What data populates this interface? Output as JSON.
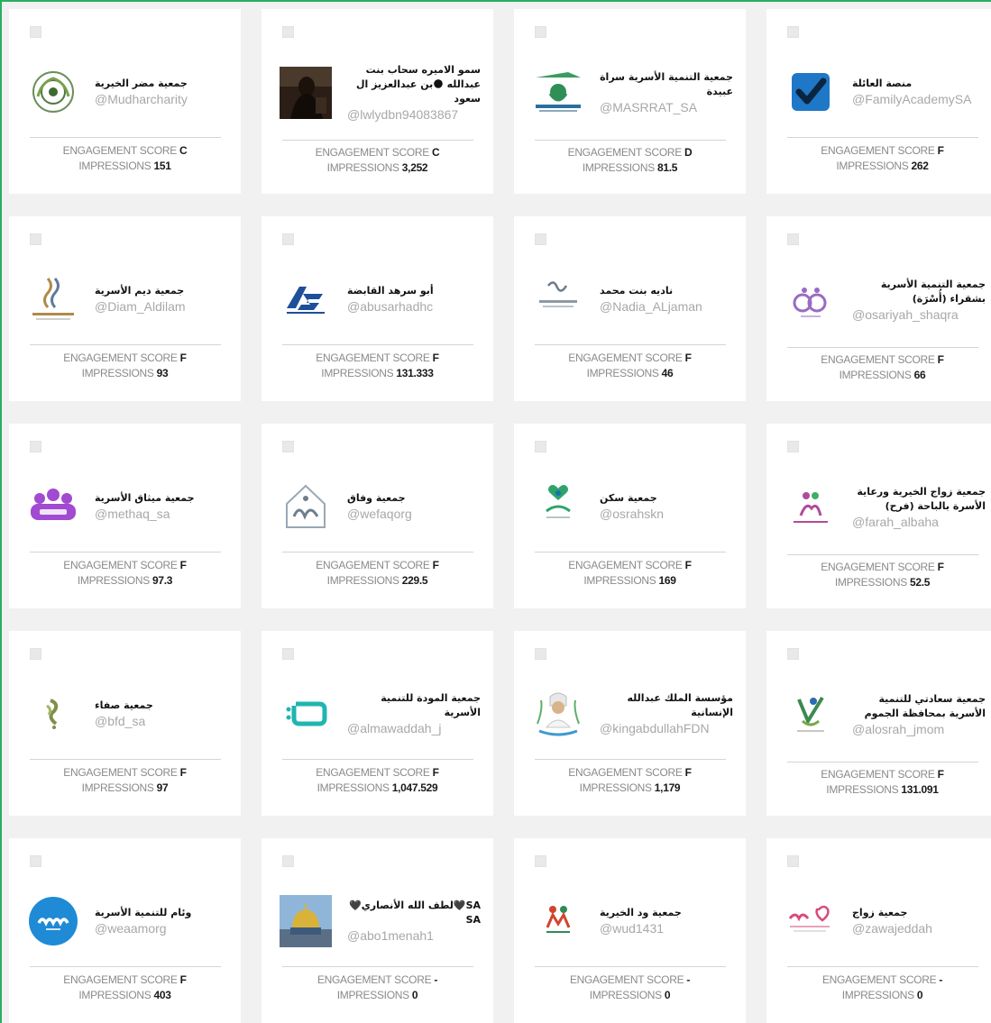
{
  "labels": {
    "engagement": "ENGAGEMENT SCORE",
    "impressions": "IMPRESSIONS"
  },
  "cards": [
    {
      "name": "جمعية مضر الخيرية",
      "handle": "@Mudharcharity",
      "score": "C",
      "impressions": "151",
      "avatar": "mudhar-logo"
    },
    {
      "name": "سمو الاميره سحاب بنت عبدالله 🌑بن عبدالعزيز ال سعود",
      "handle": "@lwlydbn94083867",
      "score": "C",
      "impressions": "3,252",
      "avatar": "profile-photo"
    },
    {
      "name": "جمعية التنمية الأسرية سراة عبيدة",
      "handle": "@MASRRAT_SA",
      "score": "D",
      "impressions": "81.5",
      "avatar": "masrrat-logo"
    },
    {
      "name": "منصة العائلة",
      "handle": "@FamilyAcademySA",
      "score": "F",
      "impressions": "262",
      "avatar": "checkmark-logo"
    },
    {
      "name": "جمعية ديم الأسرية",
      "handle": "@Diam_Aldilam",
      "score": "F",
      "impressions": "93",
      "avatar": "diam-logo"
    },
    {
      "name": "أبو سرهد القابضة",
      "handle": "@abusarhadhc",
      "score": "F",
      "impressions": "131.333",
      "avatar": "abusarhad-logo"
    },
    {
      "name": "ناديه بنت محمد",
      "handle": "@Nadia_ALjaman",
      "score": "F",
      "impressions": "46",
      "avatar": "nadia-logo"
    },
    {
      "name": "جمعية التنمية الأسرية بشقراء (أُسْرَة)",
      "handle": "@osariyah_shaqra",
      "score": "F",
      "impressions": "66",
      "avatar": "osariyah-logo"
    },
    {
      "name": "جمعية ميثاق الأسرية",
      "handle": "@methaq_sa",
      "score": "F",
      "impressions": "97.3",
      "avatar": "methaq-logo"
    },
    {
      "name": "جمعية وفاق",
      "handle": "@wefaqorg",
      "score": "F",
      "impressions": "229.5",
      "avatar": "wefaq-logo"
    },
    {
      "name": "جمعية سكن",
      "handle": "@osrahskn",
      "score": "F",
      "impressions": "169",
      "avatar": "sakan-logo"
    },
    {
      "name": "جمعية زواج الخيرية ورعاية الأسرة بالباحة (فرح)",
      "handle": "@farah_albaha",
      "score": "F",
      "impressions": "52.5",
      "avatar": "farah-logo"
    },
    {
      "name": "جمعية صفاء",
      "handle": "@bfd_sa",
      "score": "F",
      "impressions": "97",
      "avatar": "safa-logo"
    },
    {
      "name": "جمعية المودة للتنمية الأسرية",
      "handle": "@almawaddah_j",
      "score": "F",
      "impressions": "1,047.529",
      "avatar": "mawaddah-logo"
    },
    {
      "name": "مؤسسة الملك عبدالله الإنسانية",
      "handle": "@kingabdullahFDN",
      "score": "F",
      "impressions": "1,179",
      "avatar": "kingabdullah-logo"
    },
    {
      "name": "جمعية سعادتي للتنمية الأسرية بمحافظة الجموم",
      "handle": "@alosrah_jmom",
      "score": "F",
      "impressions": "131.091",
      "avatar": "saadati-logo"
    },
    {
      "name": "وئام للتنمية الأسرية",
      "handle": "@weaamorg",
      "score": "F",
      "impressions": "403",
      "avatar": "weaam-logo"
    },
    {
      "name": "SA🖤لطف الله الأنصاري🖤SA",
      "handle": "@abo1menah1",
      "score": "-",
      "impressions": "0",
      "avatar": "mosque-photo"
    },
    {
      "name": "جمعية ود الخيرية",
      "handle": "@wud1431",
      "score": "-",
      "impressions": "0",
      "avatar": "wud-logo"
    },
    {
      "name": "جمعية زواج",
      "handle": "@zawajeddah",
      "score": "-",
      "impressions": "0",
      "avatar": "zawaj-logo"
    }
  ],
  "colors": {
    "accent": "#27ae60",
    "background": "#f1f1f1",
    "card": "#ffffff"
  }
}
